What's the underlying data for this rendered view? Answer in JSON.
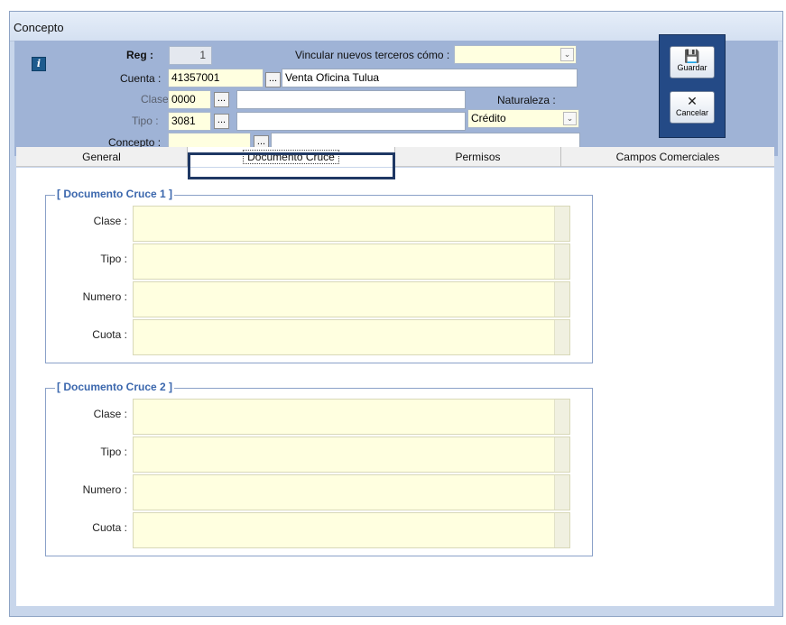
{
  "window": {
    "title": "Concepto"
  },
  "header": {
    "reg_label": "Reg :",
    "reg_value": "1",
    "vincular_label": "Vincular nuevos terceros cómo :",
    "vincular_value": "",
    "cuenta_label": "Cuenta :",
    "cuenta_code": "41357001",
    "cuenta_desc": "Venta Oficina Tulua",
    "clase_label": "Clase",
    "clase_code": "0000",
    "clase_desc": "",
    "naturaleza_label": "Naturaleza :",
    "naturaleza_value": "Crédito",
    "tipo_label": "Tipo :",
    "tipo_code": "3081",
    "tipo_desc": "",
    "concepto_label": "Concepto :",
    "concepto_code": "",
    "concepto_desc": "",
    "ellipsis": "..."
  },
  "toolbar": {
    "guardar_label": "Guardar",
    "cancelar_label": "Cancelar"
  },
  "tabs": [
    {
      "label": "General"
    },
    {
      "label": "Documento Cruce"
    },
    {
      "label": "Permisos"
    },
    {
      "label": "Campos Comerciales"
    }
  ],
  "groups": [
    {
      "title": "[ Documento Cruce 1 ]",
      "fields": [
        {
          "label": "Clase :",
          "value": ""
        },
        {
          "label": "Tipo :",
          "value": ""
        },
        {
          "label": "Numero :",
          "value": ""
        },
        {
          "label": "Cuota :",
          "value": ""
        }
      ]
    },
    {
      "title": "[ Documento Cruce 2 ]",
      "fields": [
        {
          "label": "Clase :",
          "value": ""
        },
        {
          "label": "Tipo :",
          "value": ""
        },
        {
          "label": "Numero :",
          "value": ""
        },
        {
          "label": "Cuota :",
          "value": ""
        }
      ]
    }
  ],
  "colors": {
    "header_bg": "#9fb3d6",
    "field_bg": "#ffffe0",
    "group_title": "#3b67ad",
    "highlight": "#1f3864"
  }
}
